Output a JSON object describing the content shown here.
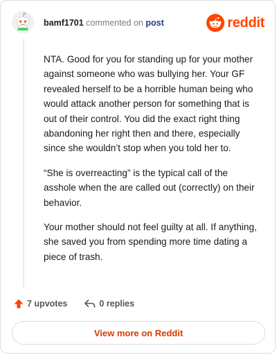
{
  "header": {
    "username": "bamf1701",
    "commented_text": "commented on",
    "post_link": "post"
  },
  "brand": {
    "name": "reddit",
    "color": "#ff4500"
  },
  "comment": {
    "paragraphs": [
      "NTA. Good for you for standing up for your mother against someone who was bullying her. Your GF revealed herself to be a horrible human being who would attack another person for something that is out of their control. You did the exact right thing abandoning her right then and there, especially since she wouldn’t stop when you told her to.",
      "“She is overreacting” is the typical call of the asshole when the are called out (correctly) on their behavior.",
      "Your mother should not feel guilty at all. If anything, she saved you from spending more time dating a piece of trash."
    ]
  },
  "actions": {
    "upvotes": "7 upvotes",
    "upvote_icon": "upvote-arrow-icon",
    "upvote_color": "#ff4500",
    "replies": "0 replies",
    "reply_icon": "reply-arrow-icon"
  },
  "cta": {
    "label": "View more on Reddit",
    "color": "#d93900"
  }
}
